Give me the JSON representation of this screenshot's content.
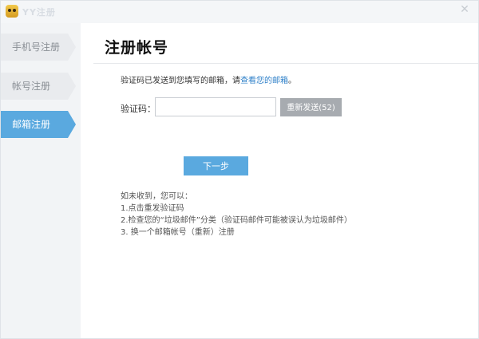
{
  "window": {
    "app_title": "YY注册",
    "logo_icon": "yy-bear-logo",
    "close_icon": "close-icon"
  },
  "sidebar": {
    "items": [
      {
        "label": "手机号注册",
        "active": false
      },
      {
        "label": "帐号注册",
        "active": false
      },
      {
        "label": "邮箱注册",
        "active": true
      }
    ]
  },
  "main": {
    "title": "注册帐号",
    "info_prefix": "验证码已发送到您填写的邮箱，请",
    "info_link": "查看您的邮箱",
    "info_suffix": "。",
    "code_label": "验证码：",
    "code_value": "",
    "resend_label": "重新发送(52)",
    "next_label": "下一步",
    "help": [
      "如未收到，您可以：",
      "1.点击重发验证码",
      "2.检查您的“垃圾邮件”分类（验证码邮件可能被误认为垃圾邮件）",
      "3. 换一个邮箱帐号（重新）注册"
    ]
  },
  "colors": {
    "accent": "#5aa9df",
    "link": "#2f80c9",
    "disabled_button": "#a7abb0"
  }
}
